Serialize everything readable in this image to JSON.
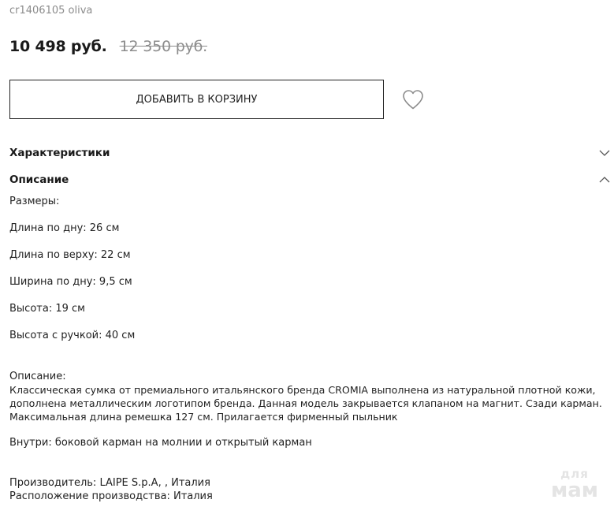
{
  "product": {
    "sku_line": "cr1406105 oliva",
    "price_current": "10 498 руб.",
    "price_old": "12 350 руб."
  },
  "actions": {
    "add_to_cart_label": "ДОБАВИТЬ В КОРЗИНУ",
    "wishlist_icon": "heart-outline-icon"
  },
  "sections": {
    "characteristics": {
      "title": "Характеристики",
      "state": "collapsed",
      "icon": "chevron-down-icon"
    },
    "description": {
      "title": "Описание",
      "state": "expanded",
      "icon": "chevron-up-icon"
    }
  },
  "description": {
    "sizes_heading": "Размеры:",
    "dimensions": [
      "Длина по дну: 26 см",
      "Длина по верху: 22 см",
      "Ширина по дну: 9,5 см",
      "Высота: 19 см",
      "Высота с ручкой: 40 см"
    ],
    "desc_heading": "Описание:",
    "desc_text": "Классическая сумка от премиального итальянского бренда CROMIA выполнена из натуральной плотной кожи, дополнена металлическим логотипом бренда. Данная модель закрывается клапаном на магнит. Сзади карман. Максимальная длина ремешка 127 см. Прилагается фирменный пыльник",
    "inside_text": "Внутри: боковой карман на молнии и открытый карман",
    "manufacturer": "Производитель: LAIPE S.p.A, , Италия",
    "origin": "Расположение производства: Италия"
  },
  "watermark": {
    "top": "для",
    "bottom": "мам"
  },
  "colors": {
    "text": "#222222",
    "muted": "#8c8c8c",
    "border": "#222222",
    "watermark": "#e4e4e4"
  }
}
